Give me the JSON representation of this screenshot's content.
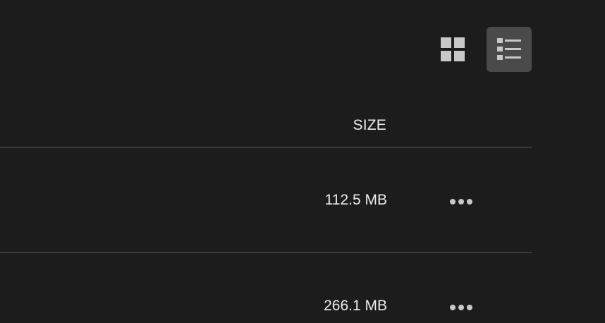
{
  "toolbar": {
    "views": [
      {
        "name": "grid-view",
        "icon": "grid-icon",
        "active": false
      },
      {
        "name": "list-view",
        "icon": "list-icon",
        "active": true
      }
    ]
  },
  "table": {
    "columns": {
      "size": "SIZE"
    },
    "rows": [
      {
        "size": "112.5 MB",
        "actions_icon": "more-icon"
      },
      {
        "size": "266.1 MB",
        "actions_icon": "more-icon"
      }
    ]
  },
  "colors": {
    "background": "#1c1c1c",
    "active_button": "#4a4a4a",
    "divider": "#3a3a3a",
    "icon": "#c8c8c8"
  }
}
